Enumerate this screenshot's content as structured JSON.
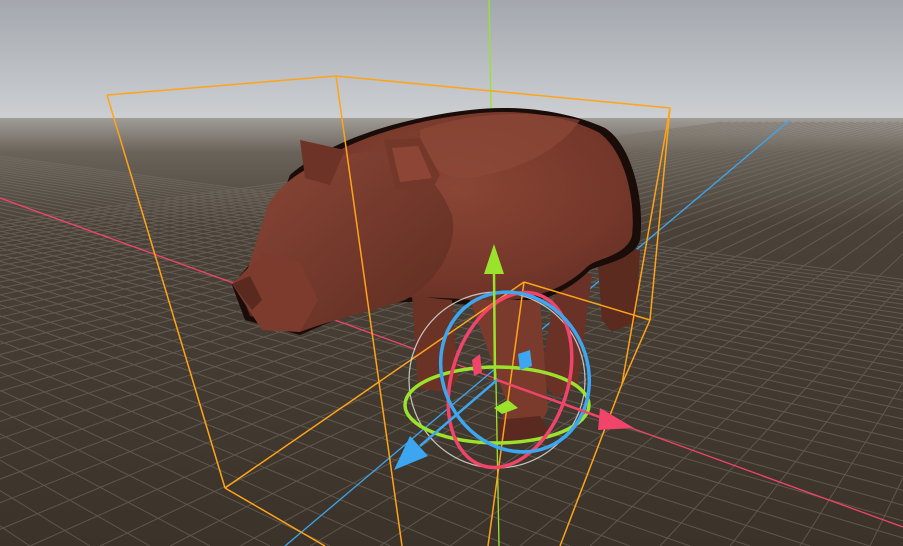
{
  "viewport": {
    "mode": "3d-perspective",
    "selected_object": "bear-model",
    "show_grid": true,
    "show_bounding_box": true,
    "gizmo": "transform-move-rotate",
    "colors": {
      "sky_top": "#a8adb3",
      "sky_horizon": "#c9ccd0",
      "ground": "#3b3329",
      "grid_line": "#6e675e",
      "x_axis": "#f0446a",
      "y_axis": "#9be22d",
      "z_axis": "#3ca6f0",
      "selection_box": "#ffa41a",
      "model_body": "#7a3a2c",
      "model_shadow": "#4a2219"
    }
  },
  "gizmo": {
    "handles": [
      {
        "axis": "x",
        "kind": "translate-arrow"
      },
      {
        "axis": "y",
        "kind": "translate-arrow"
      },
      {
        "axis": "z",
        "kind": "translate-arrow"
      },
      {
        "axis": "x",
        "kind": "rotate-ring"
      },
      {
        "axis": "y",
        "kind": "rotate-ring"
      },
      {
        "axis": "z",
        "kind": "rotate-ring"
      },
      {
        "axis": "view",
        "kind": "rotate-ring"
      },
      {
        "axis": "xy",
        "kind": "plane-handle"
      },
      {
        "axis": "xz",
        "kind": "plane-handle"
      },
      {
        "axis": "yz",
        "kind": "plane-handle"
      }
    ]
  }
}
